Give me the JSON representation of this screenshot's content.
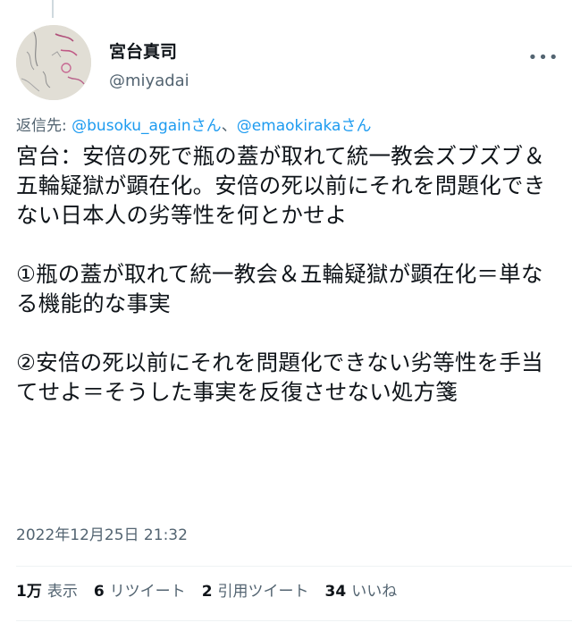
{
  "tweet": {
    "author": {
      "display_name": "宮台真司",
      "handle": "@miyadai"
    },
    "more_icon": "more-dots-icon",
    "reply_to": {
      "prefix": "返信先:",
      "mention1": "@busoku_againさん",
      "separator": "、",
      "mention2": "@emaokirakaさん"
    },
    "text": "宮台：安倍の死で瓶の蓋が取れて統一教会ズブズブ＆五輪疑獄が顕在化。安倍の死以前にそれを問題化できない日本人の劣等性を何とかせよ\n\n①瓶の蓋が取れて統一教会＆五輪疑獄が顕在化＝単なる機能的な事実\n\n②安倍の死以前にそれを問題化できない劣等性を手当てせよ＝そうした事実を反復させない処方箋",
    "timestamp": "2022年12月25日 21:32",
    "stats": {
      "views_count": "1万",
      "views_label": "表示",
      "retweets_count": "6",
      "retweets_label": "リツイート",
      "quotes_count": "2",
      "quotes_label": "引用ツイート",
      "likes_count": "34",
      "likes_label": "いいね"
    }
  },
  "colors": {
    "text": "#0f1419",
    "secondary": "#536471",
    "link": "#1d9bf0",
    "divider": "#eff3f4"
  }
}
